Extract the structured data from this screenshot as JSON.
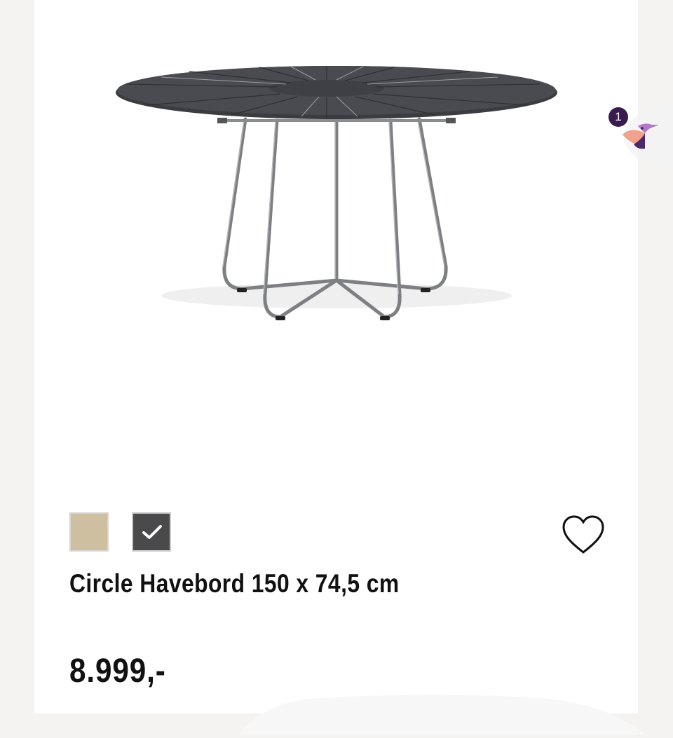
{
  "product": {
    "title": "Circle Havebord 150 x 74,5 cm",
    "price": "8.999,-",
    "image": {
      "description": "product-photo-round-table-dark-top-steel-legs"
    }
  },
  "swatches": [
    {
      "name": "sand",
      "color": "#cdbf9f",
      "selected": false
    },
    {
      "name": "dark-grey",
      "color": "#4a4a4c",
      "selected": true
    }
  ],
  "wishlist": {
    "icon": "heart-outline-icon"
  },
  "chat": {
    "badge_count": "1",
    "icon": "bird-chat-icon"
  },
  "colors": {
    "background": "#f4f3f1",
    "card": "#ffffff",
    "text": "#111111",
    "badge": "#3a1b4f"
  }
}
